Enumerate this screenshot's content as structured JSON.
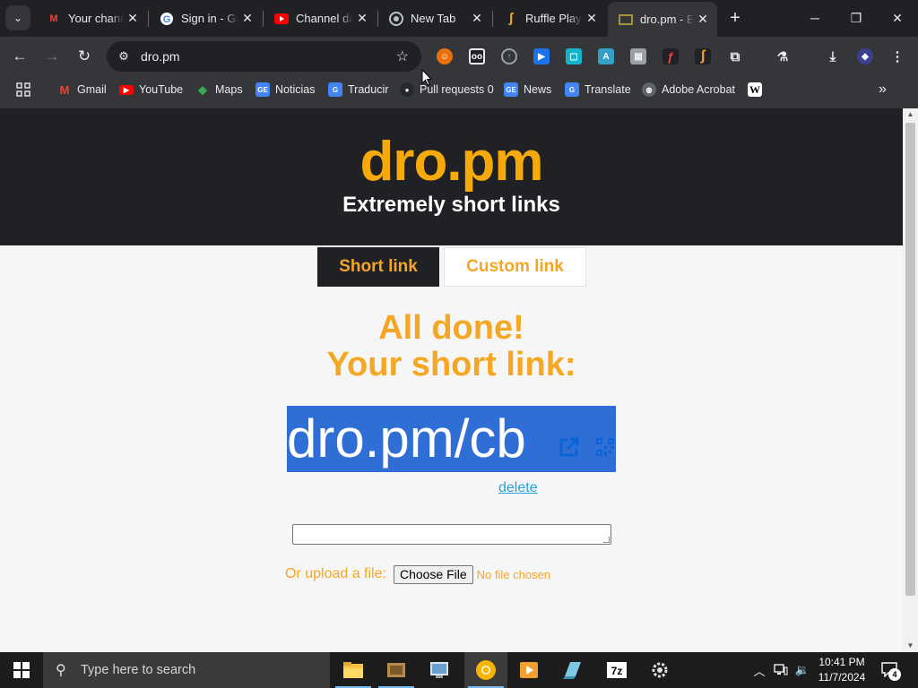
{
  "browser": {
    "tabs": [
      {
        "title": "Your channel",
        "icon": "gmail-icon"
      },
      {
        "title": "Sign in - Google",
        "icon": "google-icon"
      },
      {
        "title": "Channel dashboard",
        "icon": "youtube-icon"
      },
      {
        "title": "New Tab",
        "icon": "chrome-icon"
      },
      {
        "title": "Ruffle Player",
        "icon": "ruffle-icon"
      },
      {
        "title": "dro.pm - Extremely short links",
        "icon": "dropm-icon"
      }
    ],
    "url": "dro.pm",
    "bookmarks": [
      {
        "label": "Gmail",
        "icon": "gmail-icon",
        "color": "#ea4335"
      },
      {
        "label": "YouTube",
        "icon": "youtube-icon",
        "color": "#ff0000"
      },
      {
        "label": "Maps",
        "icon": "maps-icon",
        "color": "#34a853"
      },
      {
        "label": "Noticias",
        "icon": "google-news-icon",
        "color": "#4285f4"
      },
      {
        "label": "Traducir",
        "icon": "translate-icon",
        "color": "#4285f4"
      },
      {
        "label": "Pull requests 0",
        "icon": "github-icon",
        "color": "#24292e"
      },
      {
        "label": "News",
        "icon": "google-news-icon",
        "color": "#4285f4"
      },
      {
        "label": "Translate",
        "icon": "translate-icon",
        "color": "#4285f4"
      },
      {
        "label": "Adobe Acrobat",
        "icon": "globe-icon",
        "color": "#9aa0a6"
      },
      {
        "label": "W",
        "icon": "wikipedia-icon",
        "color": "#ffffff"
      }
    ]
  },
  "page": {
    "title": "dro.pm",
    "tagline": "Extremely short links",
    "tabs": {
      "short": "Short link",
      "custom": "Custom link"
    },
    "done_line1": "All done!",
    "done_line2": "Your short link:",
    "short_link": "dro.pm/cb",
    "delete_label": "delete",
    "upload_label": "Or upload a file:",
    "choose_file": "Choose File",
    "no_file": "No file chosen",
    "colors": {
      "accent": "#f5a623",
      "header_bg": "#202124",
      "link_box": "#2f6fd5"
    }
  },
  "taskbar": {
    "search_placeholder": "Type here to search",
    "time": "10:41 PM",
    "date": "11/7/2024",
    "notification_count": "4"
  }
}
